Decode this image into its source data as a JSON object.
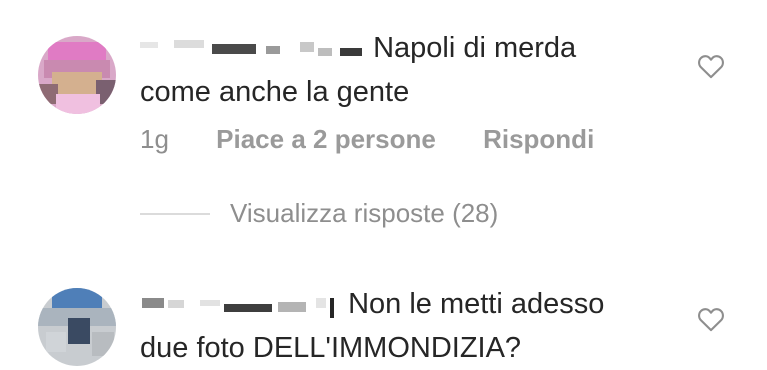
{
  "comments": [
    {
      "text_line1": "Napoli di merda",
      "text_line2": "come anche la gente",
      "time": "1g",
      "likes": "Piace a 2 persone",
      "reply": "Rispondi"
    },
    {
      "text_line1": "Non le metti adesso",
      "text_line2": "due foto DELL'IMMONDIZIA?"
    }
  ],
  "view_replies": "Visualizza risposte (28)",
  "icons": {
    "like": "heart-outline-icon"
  },
  "colors": {
    "text": "#262626",
    "secondary": "#8e8e8e",
    "divider": "#dbdbdb"
  }
}
